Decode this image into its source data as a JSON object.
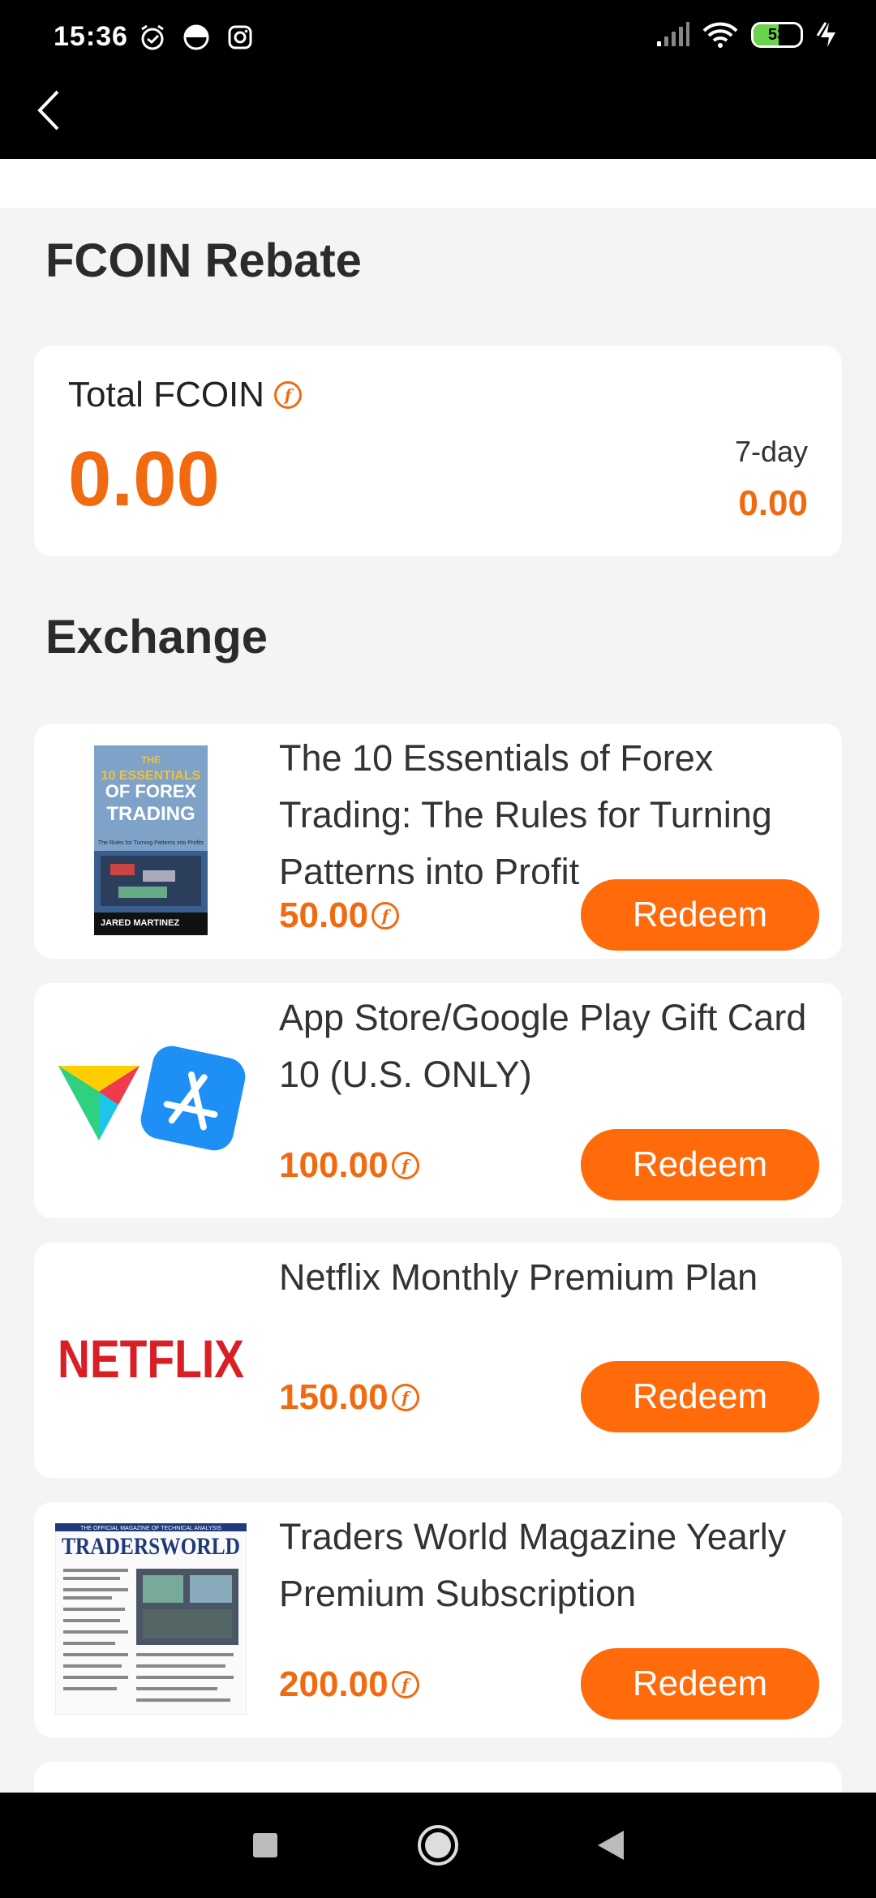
{
  "status_bar": {
    "time": "15:36",
    "battery": "53"
  },
  "page": {
    "title": "FCOIN Rebate",
    "exchange_title": "Exchange"
  },
  "summary": {
    "total_label": "Total FCOIN",
    "total_value": "0.00",
    "sevenday_label": "7-day",
    "sevenday_value": "0.00"
  },
  "products": [
    {
      "title": "The 10 Essentials of Forex Trading: The Rules for Turning Patterns into Profit",
      "price": "50.00",
      "button": "Redeem",
      "image": "book-cover-forex"
    },
    {
      "title": "App Store/Google Play Gift Card 10 (U.S. ONLY)",
      "price": "100.00",
      "button": "Redeem",
      "image": "google-play-app-store-logos"
    },
    {
      "title": "Netflix Monthly Premium Plan",
      "price": "150.00",
      "button": "Redeem",
      "image": "netflix-logo"
    },
    {
      "title": "Traders World Magazine Yearly Premium Subscription",
      "price": "200.00",
      "button": "Redeem",
      "image": "magazine-cover"
    }
  ],
  "images": {
    "book": {
      "top": "THE",
      "title1": "10 ESSENTIALS",
      "title2": "OF FOREX",
      "title3": "TRADING",
      "subtitle": "The Rules for Turning Patterns into Profits",
      "author": "JARED MARTINEZ"
    },
    "netflix": "NETFLIX",
    "magazine": {
      "header": "THE OFFICIAL MAGAZINE OF TECHNICAL ANALYSIS",
      "title": "TRADERSWORLD"
    }
  },
  "colors": {
    "accent": "#ff6a0a",
    "price": "#f26a10",
    "netflix_red": "#d81f26"
  }
}
